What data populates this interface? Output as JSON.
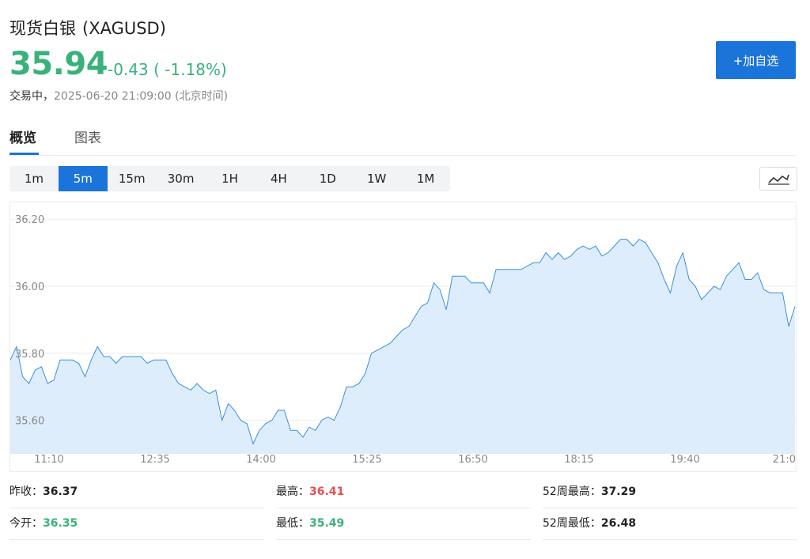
{
  "header": {
    "name": "现货白银",
    "code": "(XAGUSD)",
    "price": "35.94",
    "change": "-0.43 ( -1.18%)",
    "status_label": "交易中，",
    "timestamp": "2025-06-20 21:09:00",
    "timezone": "(北京时间)",
    "add_button": "+加自选"
  },
  "colors": {
    "accent": "#1b74d9",
    "down_green": "#39b27a",
    "up_red": "#e94e4e",
    "line": "#3a8fde",
    "fill": "#deedfb"
  },
  "tabs": [
    {
      "label": "概览",
      "active": true
    },
    {
      "label": "图表",
      "active": false
    }
  ],
  "periods": [
    "1m",
    "5m",
    "15m",
    "30m",
    "1H",
    "4H",
    "1D",
    "1W",
    "1M"
  ],
  "active_period": "5m",
  "chart_toggle_icon": "line-chart-icon",
  "chart_data": {
    "type": "area",
    "ylim": [
      35.5,
      36.25
    ],
    "yticks": [
      "36.20",
      "36.00",
      "35.80",
      "35.60"
    ],
    "xticks": [
      "11:10",
      "12:35",
      "14:00",
      "15:25",
      "16:50",
      "18:15",
      "19:40",
      "21:0"
    ],
    "values": [
      35.78,
      35.82,
      35.73,
      35.71,
      35.75,
      35.76,
      35.71,
      35.72,
      35.78,
      35.78,
      35.78,
      35.77,
      35.73,
      35.78,
      35.82,
      35.79,
      35.79,
      35.77,
      35.79,
      35.79,
      35.79,
      35.79,
      35.77,
      35.78,
      35.78,
      35.78,
      35.74,
      35.71,
      35.7,
      35.69,
      35.71,
      35.69,
      35.68,
      35.69,
      35.6,
      35.65,
      35.63,
      35.6,
      35.59,
      35.53,
      35.57,
      35.59,
      35.6,
      35.63,
      35.63,
      35.57,
      35.57,
      35.55,
      35.58,
      35.57,
      35.6,
      35.61,
      35.6,
      35.64,
      35.7,
      35.7,
      35.71,
      35.74,
      35.8,
      35.81,
      35.82,
      35.83,
      35.85,
      35.87,
      35.88,
      35.91,
      35.94,
      35.95,
      36.01,
      35.99,
      35.93,
      36.03,
      36.03,
      36.03,
      36.01,
      36.01,
      36.01,
      35.98,
      36.05,
      36.05,
      36.05,
      36.05,
      36.05,
      36.06,
      36.07,
      36.07,
      36.1,
      36.08,
      36.1,
      36.08,
      36.09,
      36.11,
      36.12,
      36.11,
      36.12,
      36.09,
      36.1,
      36.12,
      36.14,
      36.14,
      36.12,
      36.14,
      36.13,
      36.1,
      36.07,
      36.02,
      35.98,
      36.06,
      36.1,
      36.02,
      36.0,
      35.96,
      35.98,
      36.0,
      35.99,
      36.03,
      36.05,
      36.07,
      36.02,
      36.02,
      36.04,
      35.99,
      35.98,
      35.98,
      35.98,
      35.88,
      35.94
    ]
  },
  "stats": [
    {
      "label": "昨收：",
      "value": "36.37",
      "tone": "neutral"
    },
    {
      "label": "最高：",
      "value": "36.41",
      "tone": "red"
    },
    {
      "label": "52周最高：",
      "value": "37.29",
      "tone": "neutral"
    },
    {
      "label": "今开：",
      "value": "36.35",
      "tone": "green"
    },
    {
      "label": "最低：",
      "value": "35.49",
      "tone": "green"
    },
    {
      "label": "52周最低：",
      "value": "26.48",
      "tone": "neutral"
    }
  ]
}
